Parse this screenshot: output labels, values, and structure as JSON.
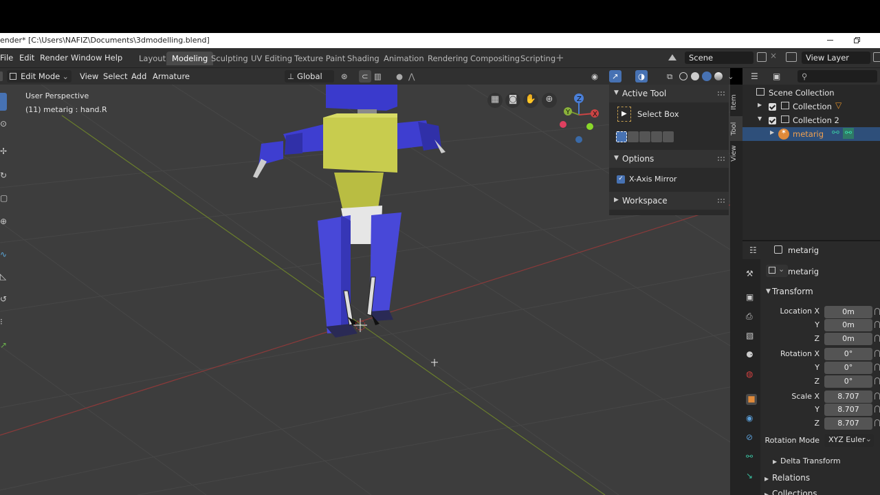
{
  "title_bar": {
    "title": "ender* [C:\\Users\\NAFIZ\\Documents\\3dmodelling.blend]"
  },
  "menu": {
    "file": "File",
    "edit": "Edit",
    "render": "Render",
    "window": "Window",
    "help": "Help"
  },
  "workspaces": [
    "Layout",
    "Modeling",
    "Sculpting",
    "UV Editing",
    "Texture Paint",
    "Shading",
    "Animation",
    "Rendering",
    "Compositing",
    "Scripting"
  ],
  "active_workspace": "Modeling",
  "scene": {
    "label": "Scene"
  },
  "view_layer": {
    "label": "View Layer"
  },
  "viewport_header": {
    "mode": "Edit Mode",
    "view": "View",
    "select": "Select",
    "add": "Add",
    "armature": "Armature",
    "orientation": "Global"
  },
  "viewport": {
    "perspective": "User Perspective",
    "object_info": "(11) metarig : hand.R"
  },
  "gizmo": {
    "z": "Z",
    "x": "X",
    "y": "Y"
  },
  "npanel": {
    "tabs": [
      "Item",
      "Tool",
      "View"
    ],
    "active_tool_header": "Active Tool",
    "tool_name": "Select Box",
    "options_header": "Options",
    "x_axis_mirror": "X-Axis Mirror",
    "workspace_header": "Workspace"
  },
  "outliner": {
    "rows": [
      {
        "label": "Scene Collection"
      },
      {
        "label": "Collection"
      },
      {
        "label": "Collection 2"
      },
      {
        "label": "metarig"
      }
    ]
  },
  "properties": {
    "header_object": "metarig",
    "object_name": "metarig",
    "transform_header": "Transform",
    "location_label": "Location X",
    "rotation_label": "Rotation X",
    "scale_label": "Scale X",
    "y": "Y",
    "z": "Z",
    "location": [
      "0m",
      "0m",
      "0m"
    ],
    "rotation": [
      "0°",
      "0°",
      "0°"
    ],
    "scale": [
      "8.707",
      "8.707",
      "8.707"
    ],
    "rotation_mode_label": "Rotation Mode",
    "rotation_mode": "XYZ Euler",
    "delta_transform": "Delta Transform",
    "relations": "Relations",
    "collections": "Collections"
  },
  "colors": {
    "robot_blue": "#3e3ed0",
    "robot_yellow": "#c9cc50",
    "selection_blue": "#2e4f7a",
    "axis_red": "#a03838",
    "axis_green": "#7a9a30"
  }
}
